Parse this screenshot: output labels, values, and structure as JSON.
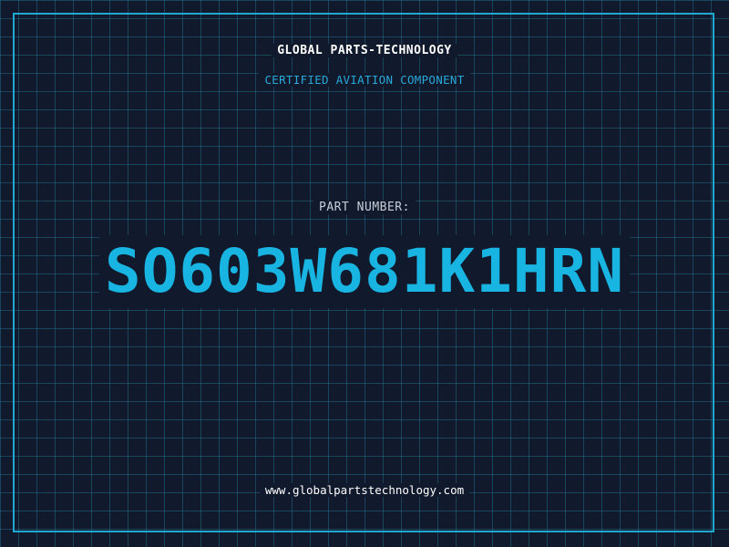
{
  "header": {
    "brand": "GLOBAL PARTS-TECHNOLOGY",
    "subtitle": "CERTIFIED AVIATION COMPONENT"
  },
  "main": {
    "label": "PART NUMBER:",
    "part_number": "SO603W681K1HRN"
  },
  "footer": {
    "url": "www.globalpartstechnology.com"
  },
  "colors": {
    "background": "#111a2c",
    "grid": "#28789a",
    "frame": "#1fa8d0",
    "accent": "#18b4e2",
    "subtitle": "#2aa8d8",
    "label": "#c6ccd8",
    "text": "#ffffff"
  }
}
